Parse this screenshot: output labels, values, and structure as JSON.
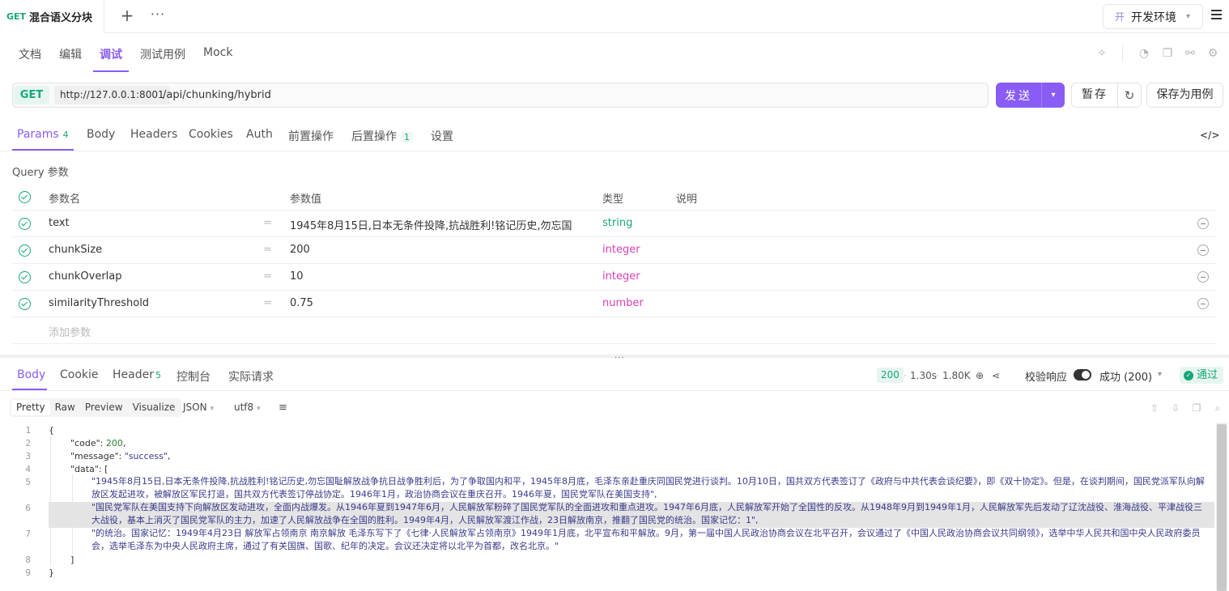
{
  "top_tab": {
    "method": "GET",
    "title": "混合语义分块"
  },
  "env": {
    "badge": "开",
    "label": "开发环境"
  },
  "subnav": {
    "items": [
      "文档",
      "编辑",
      "调试",
      "测试用例",
      "Mock"
    ],
    "active": "调试"
  },
  "url": {
    "method": "GET",
    "base": "http://127.0.0.1:8001",
    "path": "/api/chunking/hybrid"
  },
  "actions": {
    "send": "发送",
    "save_tmp": "暂存",
    "save_case": "保存为用例"
  },
  "req_tabs": {
    "params": "Params",
    "params_count": "4",
    "body": "Body",
    "headers": "Headers",
    "cookies": "Cookies",
    "auth": "Auth",
    "pre": "前置操作",
    "post": "后置操作",
    "post_count": "1",
    "settings": "设置"
  },
  "query": {
    "title": "Query 参数",
    "headers": {
      "name": "参数名",
      "value": "参数值",
      "type": "类型",
      "desc": "说明"
    },
    "rows": [
      {
        "name": "text",
        "value": "1945年8月15日,日本无条件投降,抗战胜利!铭记历史,勿忘国",
        "type": "string"
      },
      {
        "name": "chunkSize",
        "value": "200",
        "type": "integer"
      },
      {
        "name": "chunkOverlap",
        "value": "10",
        "type": "integer"
      },
      {
        "name": "similarityThreshold",
        "value": "0.75",
        "type": "number"
      }
    ],
    "add_placeholder": "添加参数"
  },
  "res_tabs": {
    "body": "Body",
    "cookie": "Cookie",
    "header": "Header",
    "header_count": "5",
    "console": "控制台",
    "actual": "实际请求"
  },
  "res_meta": {
    "status": "200",
    "time": "1.30s",
    "size": "1.80K",
    "validate": "校验响应",
    "validate_sel": "成功 (200)",
    "result": "通过"
  },
  "view": {
    "modes": [
      "Pretty",
      "Raw",
      "Preview",
      "Visualize"
    ],
    "active": "Pretty",
    "format": "JSON",
    "encoding": "utf8"
  },
  "code": {
    "l1": "{",
    "l2_key": "\"code\"",
    "l2_val": "200",
    "l3_key": "\"message\"",
    "l3_val": "\"success\"",
    "l4_key": "\"data\"",
    "l5": "\"1945年8月15日,日本无条件投降,抗战胜利!铭记历史,勿忘国耻解放战争抗日战争胜利后，为了争取国内和平，1945年8月底，毛泽东亲赴重庆同国民党进行谈判。10月10日，国共双方代表签订了《政府与中共代表会谈纪要》，即《双十协定》。但是，在谈判期间，国民党派军队向解放区发起进攻，被解放区军民打退，国共双方代表签订停战协定。1946年1月，政治协商会议在重庆召开。1946年夏，国民党军队在美国支持\",",
    "l6": "\"国民党军队在美国支持下向解放区发动进攻，全面内战爆发。从1946年夏到1947年6月，人民解放军粉碎了国民党军队的全面进攻和重点进攻。1947年6月底，人民解放军开始了全国性的反攻。从1948年9月到1949年1月，人民解放军先后发动了辽沈战役、淮海战役、平津战役三大战役，基本上消灭了国民党军队的主力，加速了人民解放战争在全国的胜利。1949年4月，人民解放军渡江作战，23日解放南京，推翻了国民党的统治。国家记忆：1\",",
    "l7": "\"的统治。国家记忆：1949年4月23日 解放军占领南京 南京解放 毛泽东写下了《七律·人民解放军占领南京》1949年1月底，北平宣布和平解放。9月，第一届中国人民政治协商会议在北平召开，会议通过了《中国人民政治协商会议共同纲领》，选举中华人民共和国中央人民政府委员会，选举毛泽东为中央人民政府主席，通过了有关国旗、国歌、纪年的决定。会议还决定将以北平为首都，改名北京。\"",
    "l8": "]",
    "l9": "}"
  }
}
